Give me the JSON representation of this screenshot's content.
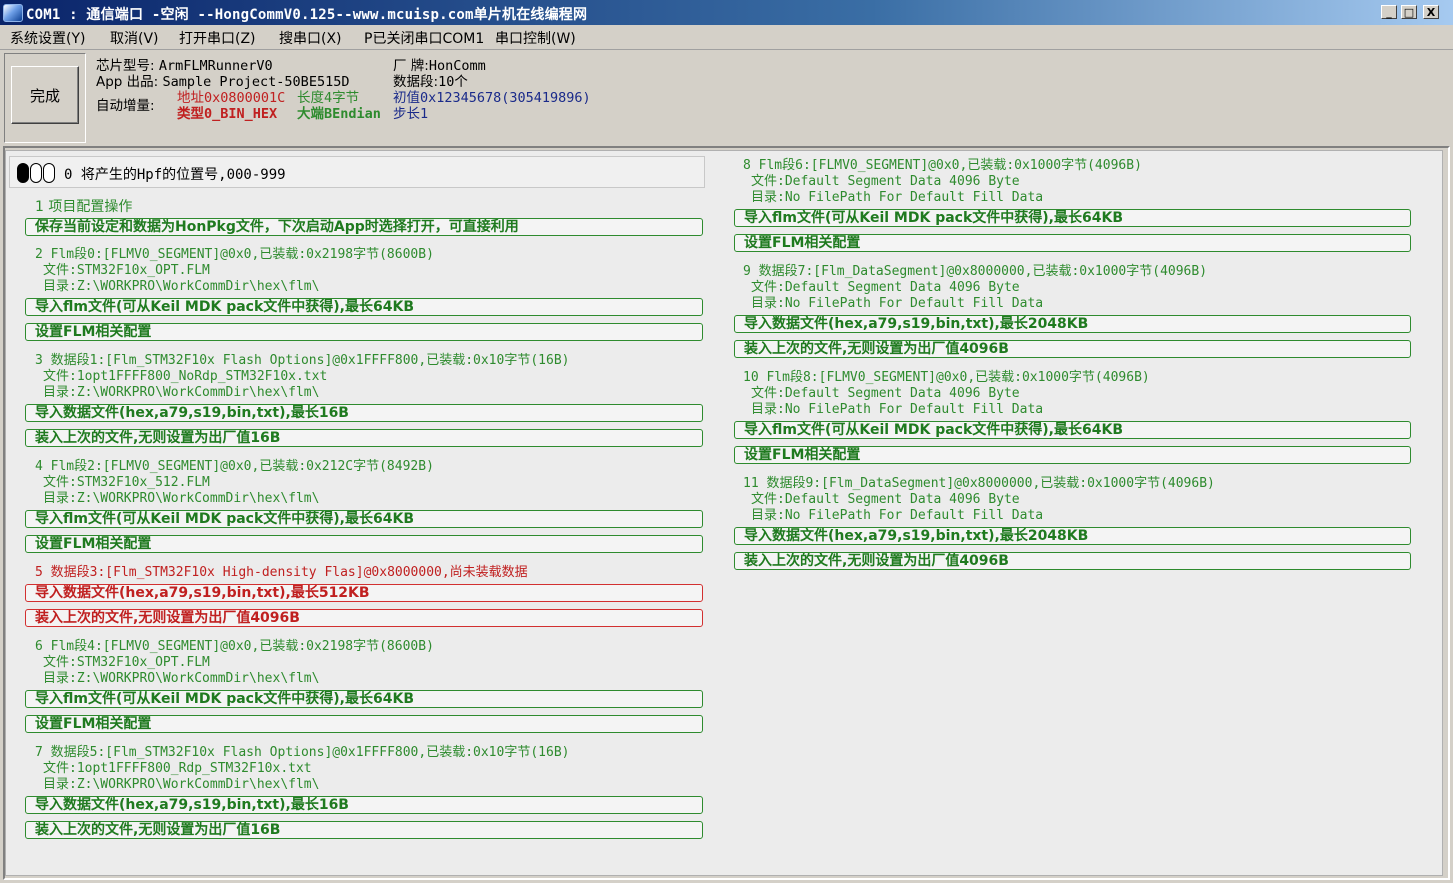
{
  "window": {
    "title": "COM1 : 通信端口 -空闲  --HongCommV0.125--www.mcuisp.com单片机在线编程网",
    "min": "_",
    "max": "□",
    "close": "X"
  },
  "menu": [
    "系统设置(Y)",
    "取消(V)",
    "打开串口(Z)",
    "搜串口(X)",
    "P已关闭串口COM1",
    "串口控制(W)"
  ],
  "toolbar": {
    "done_label": "完成"
  },
  "info": {
    "chip_label": "芯片型号:",
    "chip_value": "ArmFLMRunnerV0",
    "vendor_label": "厂  牌:",
    "vendor_value": "HonComm",
    "app_label": "App 出品:",
    "app_value": "Sample Project-50BE515D",
    "segs_label": "数据段:",
    "segs_value": "10个",
    "auto_label": "自动增量:",
    "addr": "地址0x0800001C",
    "len": "长度4字节",
    "init": "初值0x12345678(305419896)",
    "type": "类型0_BIN_HEX",
    "endian": "大端BEndian",
    "step": "步长1"
  },
  "hpf": {
    "value": "0",
    "text": "0 将产生的Hpf的位置号,000-999"
  },
  "left": {
    "p1_cap": "1 项目配置操作",
    "p1_btn": "保存当前设定和数据为HonPkg文件，下次启动App时选择打开，可直接利用",
    "s2_cap": "2  Flm段0:[FLMV0_SEGMENT]@0x0,已装载:0x2198字节(8600B)",
    "s2_file": "文件:STM32F10x_OPT.FLM",
    "s2_dir": "目录:Z:\\WORKPRO\\WorkCommDir\\hex\\flm\\",
    "s2_btn1": "导入flm文件(可从Keil MDK pack文件中获得),最长64KB",
    "s2_btn2": "设置FLM相关配置",
    "s3_cap": "3 数据段1:[Flm_STM32F10x Flash Options]@0x1FFFF800,已装载:0x10字节(16B)",
    "s3_file": "文件:1opt1FFFF800_NoRdp_STM32F10x.txt",
    "s3_dir": "目录:Z:\\WORKPRO\\WorkCommDir\\hex\\flm\\",
    "s3_btn1": "导入数据文件(hex,a79,s19,bin,txt),最长16B",
    "s3_btn2": "装入上次的文件,无则设置为出厂值16B",
    "s4_cap": "4  Flm段2:[FLMV0_SEGMENT]@0x0,已装载:0x212C字节(8492B)",
    "s4_file": "文件:STM32F10x_512.FLM",
    "s4_dir": "目录:Z:\\WORKPRO\\WorkCommDir\\hex\\flm\\",
    "s4_btn1": "导入flm文件(可从Keil MDK pack文件中获得),最长64KB",
    "s4_btn2": "设置FLM相关配置",
    "s5_cap": "5 数据段3:[Flm_STM32F10x High-density Flas]@0x8000000,尚未装载数据",
    "s5_btn1": "导入数据文件(hex,a79,s19,bin,txt),最长512KB",
    "s5_btn2": "装入上次的文件,无则设置为出厂值4096B",
    "s6_cap": "6  Flm段4:[FLMV0_SEGMENT]@0x0,已装载:0x2198字节(8600B)",
    "s6_file": "文件:STM32F10x_OPT.FLM",
    "s6_dir": "目录:Z:\\WORKPRO\\WorkCommDir\\hex\\flm\\",
    "s6_btn1": "导入flm文件(可从Keil MDK pack文件中获得),最长64KB",
    "s6_btn2": "设置FLM相关配置",
    "s7_cap": "7 数据段5:[Flm_STM32F10x Flash Options]@0x1FFFF800,已装载:0x10字节(16B)",
    "s7_file": "文件:1opt1FFFF800_Rdp_STM32F10x.txt",
    "s7_dir": "目录:Z:\\WORKPRO\\WorkCommDir\\hex\\flm\\",
    "s7_btn1": "导入数据文件(hex,a79,s19,bin,txt),最长16B",
    "s7_btn2": "装入上次的文件,无则设置为出厂值16B"
  },
  "right": {
    "s8_cap": "8  Flm段6:[FLMV0_SEGMENT]@0x0,已装载:0x1000字节(4096B)",
    "s8_file": "文件:Default Segment Data 4096 Byte",
    "s8_dir": "目录:No FilePath For Default Fill Data",
    "s8_btn1": "导入flm文件(可从Keil MDK pack文件中获得),最长64KB",
    "s8_btn2": "设置FLM相关配置",
    "s9_cap": "9 数据段7:[Flm_DataSegment]@0x8000000,已装载:0x1000字节(4096B)",
    "s9_file": "文件:Default Segment Data 4096 Byte",
    "s9_dir": "目录:No FilePath For Default Fill Data",
    "s9_btn1": "导入数据文件(hex,a79,s19,bin,txt),最长2048KB",
    "s9_btn2": "装入上次的文件,无则设置为出厂值4096B",
    "s10_cap": "10  Flm段8:[FLMV0_SEGMENT]@0x0,已装载:0x1000字节(4096B)",
    "s10_file": "文件:Default Segment Data 4096 Byte",
    "s10_dir": "目录:No FilePath For Default Fill Data",
    "s10_btn1": "导入flm文件(可从Keil MDK pack文件中获得),最长64KB",
    "s10_btn2": "设置FLM相关配置",
    "s11_cap": "11 数据段9:[Flm_DataSegment]@0x8000000,已装载:0x1000字节(4096B)",
    "s11_file": "文件:Default Segment Data 4096 Byte",
    "s11_dir": "目录:No FilePath For Default Fill Data",
    "s11_btn1": "导入数据文件(hex,a79,s19,bin,txt),最长2048KB",
    "s11_btn2": "装入上次的文件,无则设置为出厂值4096B"
  },
  "colors": {
    "green": "#2e8b2e",
    "red": "#c02020",
    "title_blue": "#0a246a"
  }
}
